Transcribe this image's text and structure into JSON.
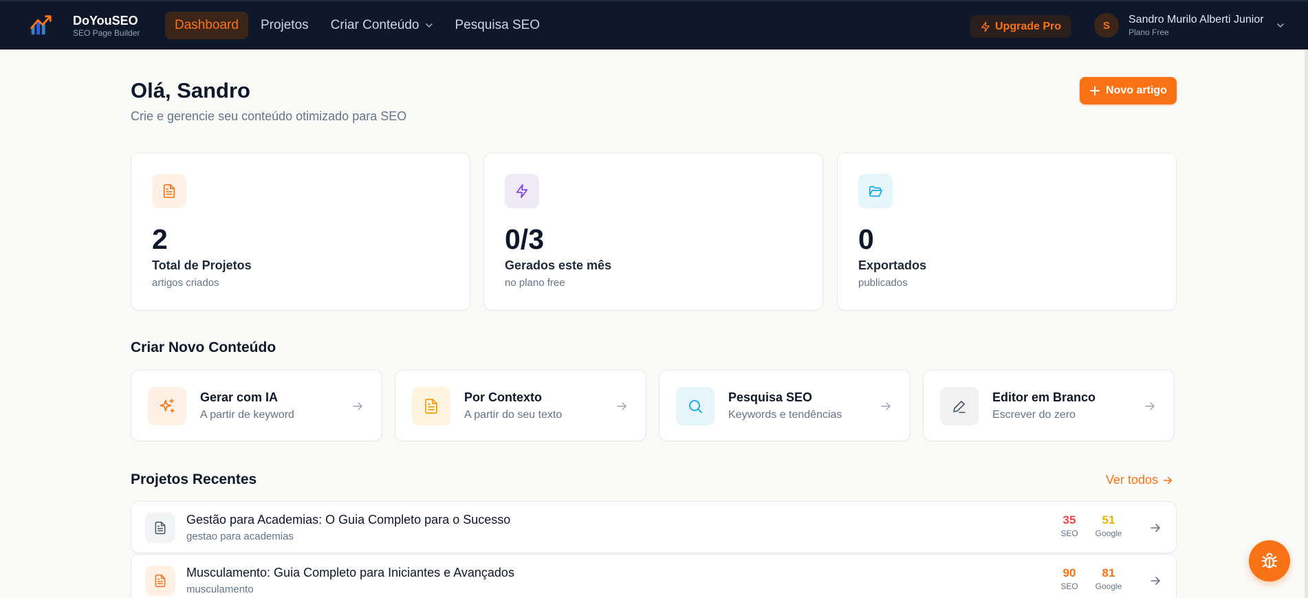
{
  "brand": {
    "name": "DoYouSEO",
    "tagline": "SEO Page Builder"
  },
  "nav": {
    "items": [
      {
        "label": "Dashboard",
        "active": true
      },
      {
        "label": "Projetos",
        "active": false
      },
      {
        "label": "Criar Conteúdo",
        "active": false,
        "dropdown": true
      },
      {
        "label": "Pesquisa SEO",
        "active": false
      }
    ],
    "upgrade_label": "Upgrade Pro"
  },
  "user": {
    "initial": "S",
    "name": "Sandro Murilo Alberti Junior",
    "plan": "Plano Free"
  },
  "header": {
    "greeting": "Olá, Sandro",
    "subtitle": "Crie e gerencie seu conteúdo otimizado para SEO",
    "new_button": "Novo artigo"
  },
  "stats": [
    {
      "icon": "document-icon",
      "value": "2",
      "label": "Total de Projetos",
      "note": "artigos criados",
      "color": "#f97316",
      "bg": "#fff1e6"
    },
    {
      "icon": "lightning-icon",
      "value": "0/3",
      "label": "Gerados este mês",
      "note": "no plano free",
      "color": "#7c3aed",
      "bg": "#efeaf8"
    },
    {
      "icon": "folder-open-icon",
      "value": "0",
      "label": "Exportados",
      "note": "publicados",
      "color": "#0ea5e9",
      "bg": "#e6f4fb"
    }
  ],
  "create_section": {
    "title": "Criar Novo Conteúdo",
    "options": [
      {
        "icon": "sparkles-icon",
        "title": "Gerar com IA",
        "desc": "A partir de keyword",
        "color": "#f97316",
        "bg": "#fff1e6"
      },
      {
        "icon": "document-icon",
        "title": "Por Contexto",
        "desc": "A partir do seu texto",
        "color": "#f59e0b",
        "bg": "#fff4e0"
      },
      {
        "icon": "search-icon",
        "title": "Pesquisa SEO",
        "desc": "Keywords e tendências",
        "color": "#0ea5e9",
        "bg": "#e6f4fb"
      },
      {
        "icon": "pencil-icon",
        "title": "Editor em Branco",
        "desc": "Escrever do zero",
        "color": "#475569",
        "bg": "#f1f1f1"
      }
    ]
  },
  "recent": {
    "title": "Projetos Recentes",
    "see_all": "Ver todos",
    "seo_label": "SEO",
    "google_label": "Google",
    "items": [
      {
        "title": "Gestão para Academias: O Guia Completo para o Sucesso",
        "keyword": "gestao para academias",
        "seo": "35",
        "google": "51",
        "seo_color": "#ef4444",
        "google_color": "#eab308",
        "icon_color": "#475569",
        "icon_bg": "#f3f4f6"
      },
      {
        "title": "Musculamento: Guia Completo para Iniciantes e Avançados",
        "keyword": "musculamento",
        "seo": "90",
        "google": "81",
        "seo_color": "#f97316",
        "google_color": "#f97316",
        "icon_color": "#f97316",
        "icon_bg": "#fff1e6"
      }
    ]
  },
  "colors": {
    "accent": "#f97316",
    "nav_bg": "#0f172a",
    "page_bg": "#fafaf9"
  }
}
